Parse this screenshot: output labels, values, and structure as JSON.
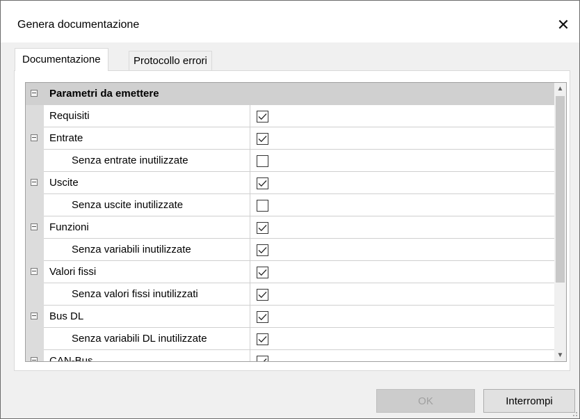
{
  "window": {
    "title": "Genera documentazione",
    "close_glyph": "✕"
  },
  "tabs": [
    {
      "label": "Documentazione",
      "active": true
    },
    {
      "label": "Protocollo errori",
      "active": false
    }
  ],
  "grid": {
    "header": "Parametri da emettere",
    "rows": [
      {
        "label": "Requisiti",
        "checked": true
      },
      {
        "label": "Entrate",
        "checked": true
      },
      {
        "label": "Senza entrate inutilizzate",
        "checked": false
      },
      {
        "label": "Uscite",
        "checked": true
      },
      {
        "label": "Senza uscite inutilizzate",
        "checked": false
      },
      {
        "label": "Funzioni",
        "checked": true
      },
      {
        "label": "Senza variabili inutilizzate",
        "checked": true
      },
      {
        "label": "Valori fissi",
        "checked": true
      },
      {
        "label": "Senza valori fissi inutilizzati",
        "checked": true
      },
      {
        "label": "Bus DL",
        "checked": true
      },
      {
        "label": "Senza variabili DL inutilizzate",
        "checked": true
      },
      {
        "label": "CAN-Bus",
        "checked": true
      }
    ]
  },
  "buttons": {
    "ok": "OK",
    "cancel": "Interrompi"
  },
  "scroll": {
    "up_glyph": "▲",
    "down_glyph": "▼"
  }
}
